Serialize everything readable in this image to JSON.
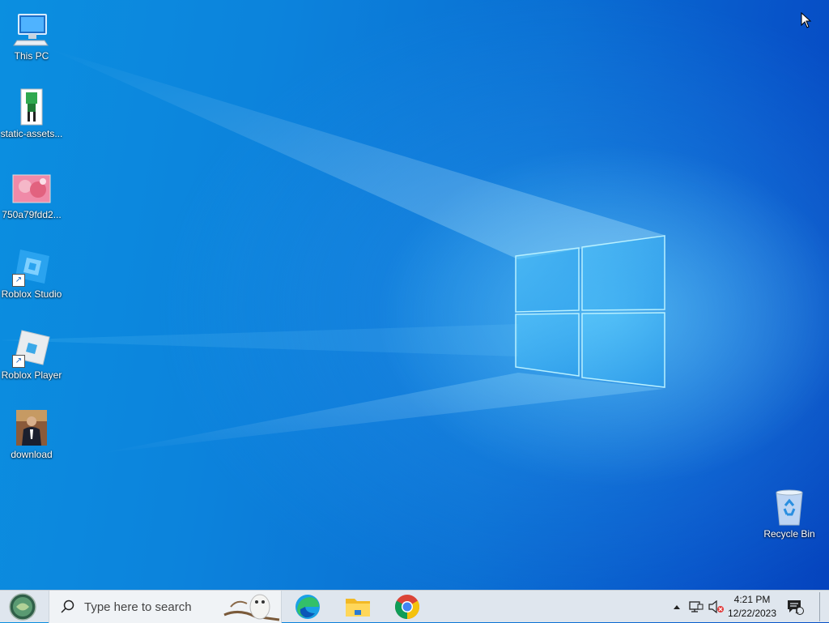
{
  "desktop": {
    "icons": [
      {
        "label": "This PC",
        "icon": "computer-icon"
      },
      {
        "label": "static-assets...",
        "icon": "image-file-icon"
      },
      {
        "label": "750a79fdd2...",
        "icon": "image-file-icon"
      },
      {
        "label": "Roblox Studio",
        "icon": "roblox-studio-icon"
      },
      {
        "label": "Roblox Player",
        "icon": "roblox-player-icon"
      },
      {
        "label": "download",
        "icon": "image-file-icon"
      }
    ],
    "recycle_bin": {
      "label": "Recycle Bin",
      "icon": "recycle-bin-icon"
    }
  },
  "taskbar": {
    "search_placeholder": "Type here to search",
    "pinned_apps": [
      "Microsoft Edge",
      "File Explorer",
      "Google Chrome"
    ],
    "clock": {
      "time": "4:21 PM",
      "date": "12/22/2023"
    },
    "notification_count": "1"
  },
  "colors": {
    "accent": "#0a78d8",
    "taskbar_bg": "#dfe6ee"
  }
}
